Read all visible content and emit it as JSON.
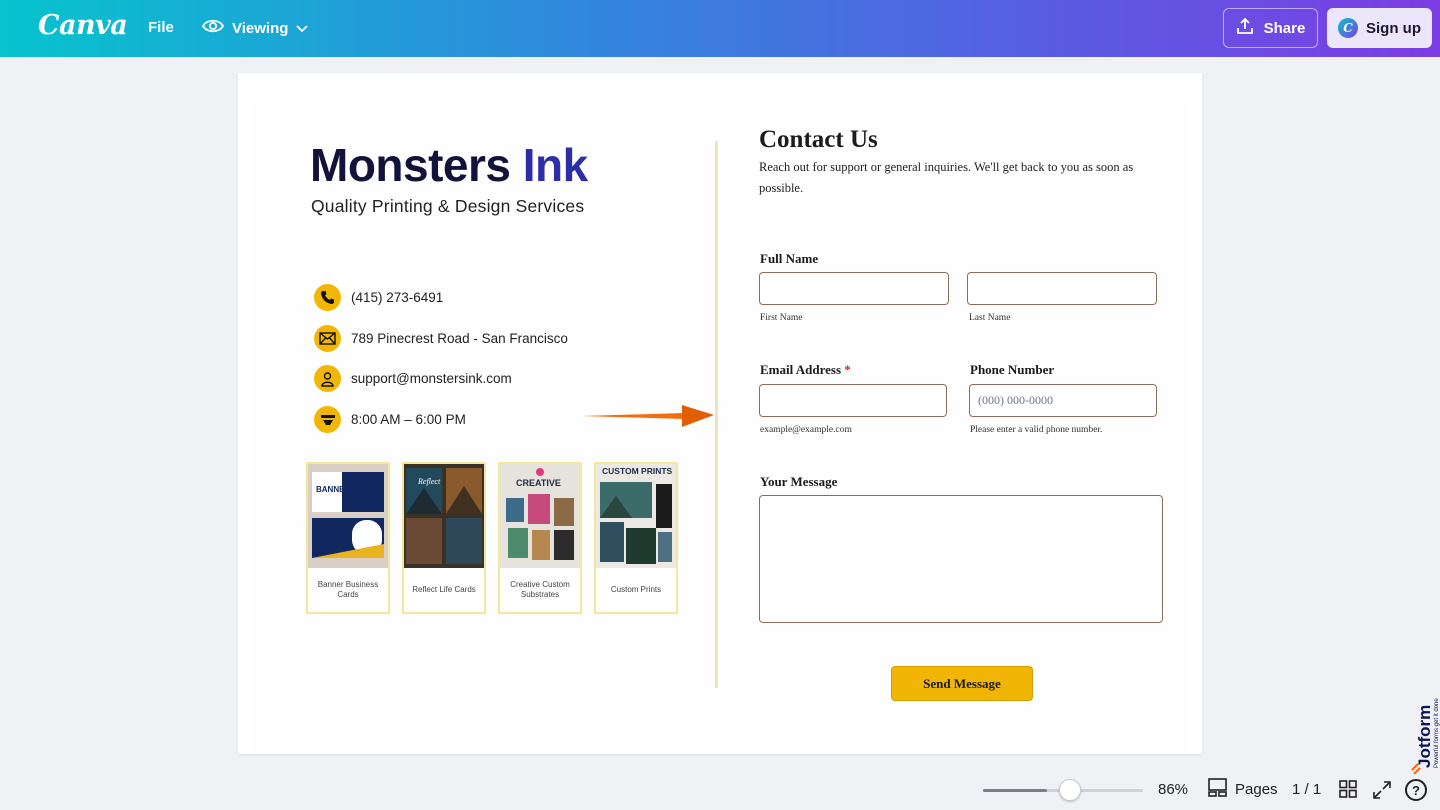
{
  "topbar": {
    "logo": "Canva",
    "file_label": "File",
    "viewing_label": "Viewing",
    "share_label": "Share",
    "signup_label": "Sign up"
  },
  "left": {
    "brand_main": "Monsters",
    "brand_accent": "Ink",
    "tagline": "Quality Printing & Design Services",
    "contacts": [
      {
        "icon": "phone-icon",
        "text": "(415) 273-6491"
      },
      {
        "icon": "mail-icon",
        "text": "789 Pinecrest Road - San Francisco"
      },
      {
        "icon": "person-icon",
        "text": "support@monstersink.com"
      },
      {
        "icon": "clock-icon",
        "text": "8:00 AM – 6:00 PM"
      }
    ],
    "thumbnails": [
      {
        "caption": "Banner Business Cards",
        "art_text": "BANNER"
      },
      {
        "caption": "Reflect Life Cards",
        "art_text": "Reflect"
      },
      {
        "caption": "Creative Custom Substrates",
        "art_text": "CREATIVE"
      },
      {
        "caption": "Custom Prints",
        "art_text": "CUSTOM PRINTS"
      }
    ]
  },
  "form": {
    "title": "Contact Us",
    "description": "Reach out for support or general inquiries. We'll get back to you as soon as possible.",
    "full_name_label": "Full Name",
    "first_name_sub": "First Name",
    "last_name_sub": "Last Name",
    "email_label": "Email Address",
    "email_required": "*",
    "email_sub": "example@example.com",
    "phone_label": "Phone Number",
    "phone_placeholder": "(000) 000-0000",
    "phone_sub": "Please enter a valid phone number.",
    "message_label": "Your Message",
    "send_label": "Send Message"
  },
  "jotform": {
    "name": "Jotform",
    "tagline": "Powerful forms get it done"
  },
  "bottombar": {
    "zoom_text": "86%",
    "zoom_level_percent": 86,
    "pages_label": "Pages",
    "page_count": "1 / 1"
  },
  "colors": {
    "accent_yellow": "#f2b705",
    "brand_navy": "#12123b",
    "brand_blue": "#2e2da8",
    "arrow_orange": "#f26f0f"
  }
}
